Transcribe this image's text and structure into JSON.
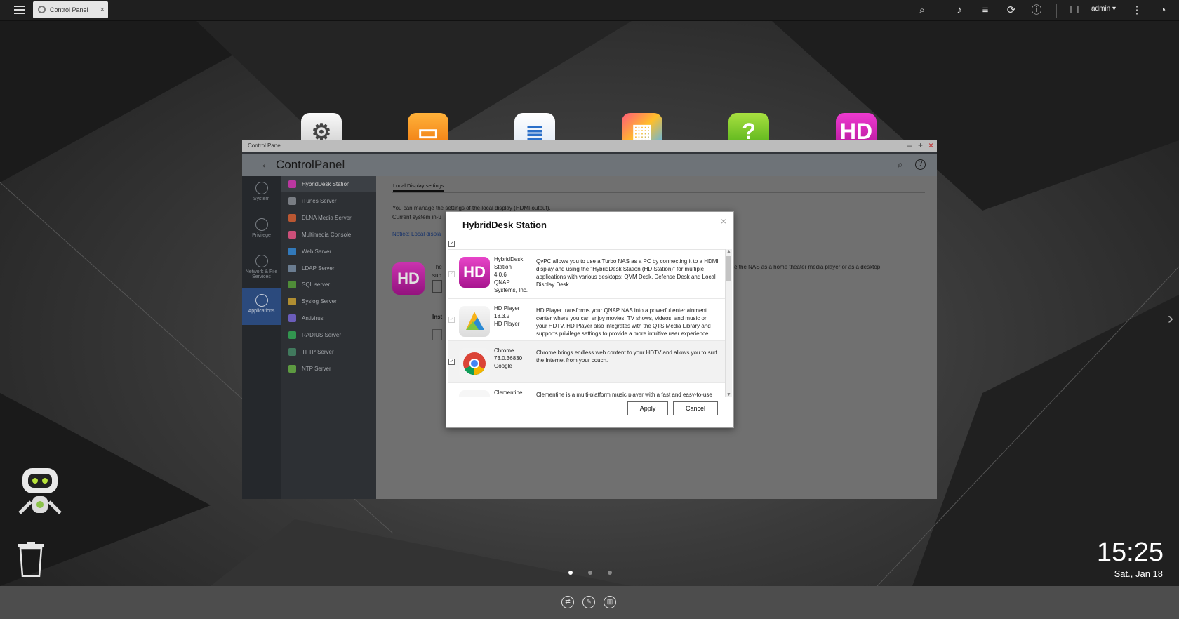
{
  "topbar": {
    "tab_label": "Control Panel",
    "tab_close": "×",
    "user": "admin ▾"
  },
  "window": {
    "title_small": "Control Panel",
    "min": "–",
    "max": "+",
    "close": "×",
    "header_title_a": "Control",
    "header_title_b": "Panel",
    "back": "←",
    "help": "?"
  },
  "categories": [
    {
      "label": "System"
    },
    {
      "label": "Privilege"
    },
    {
      "label": "Network & File Services"
    },
    {
      "label": "Applications",
      "active": true
    }
  ],
  "sidebar_items": [
    {
      "label": "HybridDesk Station",
      "color": "#d43fb7",
      "active": true
    },
    {
      "label": "iTunes Server",
      "color": "#8a8f96"
    },
    {
      "label": "DLNA Media Server",
      "color": "#d4643a"
    },
    {
      "label": "Multimedia Console",
      "color": "#e85a8a"
    },
    {
      "label": "Web Server",
      "color": "#3a8ad4"
    },
    {
      "label": "LDAP Server",
      "color": "#7a8fa6"
    },
    {
      "label": "SQL server",
      "color": "#5aa040"
    },
    {
      "label": "Syslog Server",
      "color": "#c9a23a"
    },
    {
      "label": "Antivirus",
      "color": "#7a6ad4"
    },
    {
      "label": "RADIUS Server",
      "color": "#3aaa5a"
    },
    {
      "label": "TFTP Server",
      "color": "#4a8a6a"
    },
    {
      "label": "NTP Server",
      "color": "#6ab04a"
    }
  ],
  "main": {
    "subtab": "Local Display settings",
    "desc1": "You can manage the settings of the local display (HDMI output).",
    "desc2": "Current system in-u",
    "notice_label": "Notice:",
    "notice_text": "Local displa",
    "hd_line_start": "The",
    "hd_line_end": "o use the NAS as a home theater media player or as a desktop",
    "hd_line2": "sub",
    "install_label": "Inst",
    "hd_logo": "HD"
  },
  "dialog": {
    "title": "HybridDesk Station",
    "close": "×",
    "select_all": "☑",
    "apps": [
      {
        "name": "HybridDesk Station",
        "version": "4.0.6",
        "vendor": "QNAP Systems, Inc.",
        "desc": "QvPC allows you to use a Turbo NAS as a PC by connecting it to a HDMI display and using the \"HybridDesk Station (HD Station)\" for multiple applications with various desktops: QVM Desk, Defense Desk and Local Display Desk.",
        "checked": true,
        "disabled": true,
        "icon": "hd-station-icon",
        "icon_text": "HD"
      },
      {
        "name": "HD Player",
        "version": "18.3.2",
        "vendor": "HD Player",
        "desc": "HD Player transforms your QNAP NAS into a powerful entertainment center where you can enjoy movies, TV shows, videos, and music on your HDTV. HD Player also integrates with the QTS Media Library and supports privilege settings to provide a more intuitive user experience.",
        "checked": true,
        "disabled": true,
        "icon": "hd-player-icon"
      },
      {
        "name": "Chrome",
        "version": "73.0.36830",
        "vendor": "Google",
        "desc": "Chrome brings endless web content to your HDTV and allows you to surf the Internet from your couch.",
        "checked": true,
        "disabled": false,
        "icon": "chrome-icon"
      },
      {
        "name": "Clementine",
        "version": "",
        "vendor": "",
        "desc": "Clementine is a multi-platform music player with a fast and easy-to-use",
        "checked": false,
        "disabled": false,
        "icon": "clementine-icon"
      }
    ],
    "apply": "Apply",
    "cancel": "Cancel"
  },
  "clock": {
    "time": "15:25",
    "date": "Sat., Jan 18"
  },
  "desktop_apps": [
    {
      "icon": "settings-app-icon"
    },
    {
      "icon": "file-station-app-icon"
    },
    {
      "icon": "storage-app-icon"
    },
    {
      "icon": "app-center-app-icon"
    },
    {
      "icon": "help-center-app-icon"
    },
    {
      "icon": "hybriddesk-app-icon",
      "text": "HD"
    }
  ]
}
